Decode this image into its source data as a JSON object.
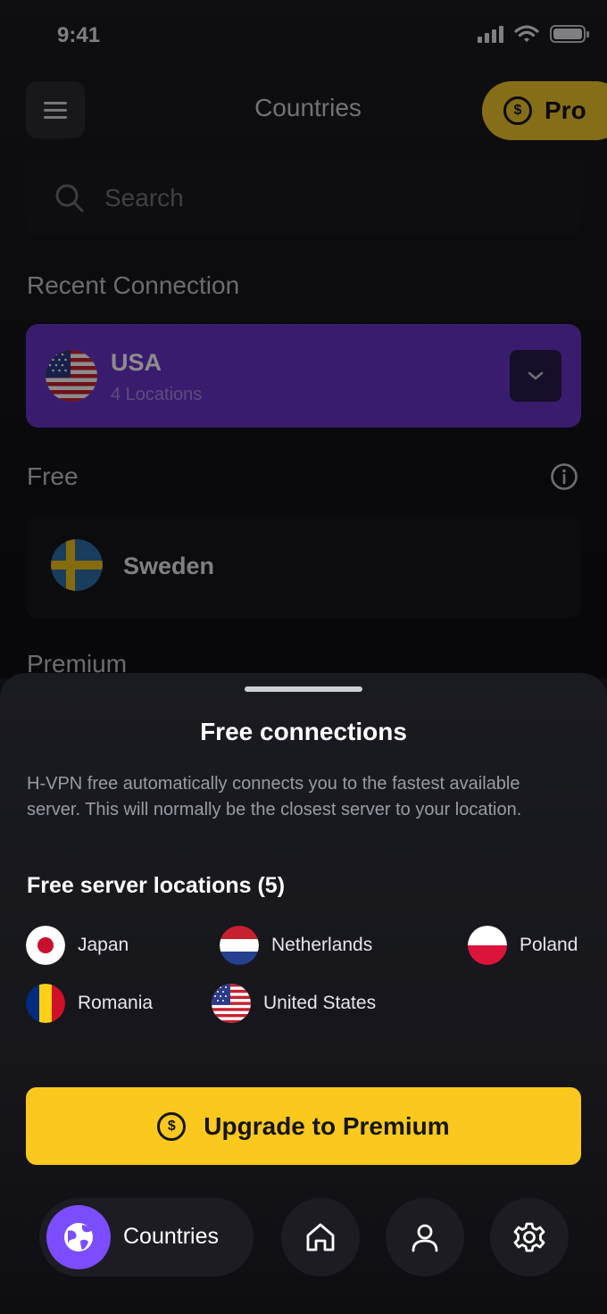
{
  "status_bar": {
    "time": "9:41"
  },
  "header": {
    "title": "Countries",
    "pro_label": "Pro",
    "coin_symbol": "$"
  },
  "search": {
    "placeholder": "Search"
  },
  "recent": {
    "section_label": "Recent Connection",
    "country": "USA",
    "subtitle": "4 Locations"
  },
  "free": {
    "section_label": "Free",
    "country": "Sweden"
  },
  "premium": {
    "section_label": "Premium"
  },
  "sheet": {
    "title": "Free connections",
    "description": "H-VPN free automatically connects you to the fastest available server. This will normally be the closest server to your location.",
    "locations_title": "Free server locations (5)",
    "locations": [
      {
        "name": "Japan",
        "flag": "japan-flag"
      },
      {
        "name": "Netherlands",
        "flag": "netherlands-flag"
      },
      {
        "name": "Poland",
        "flag": "poland-flag"
      },
      {
        "name": "Romania",
        "flag": "romania-flag"
      },
      {
        "name": "United States",
        "flag": "usa-flag"
      }
    ],
    "upgrade_label": "Upgrade to Premium"
  },
  "nav": {
    "countries_label": "Countries",
    "items": [
      "globe-icon",
      "home-icon",
      "user-icon",
      "gear-icon"
    ]
  },
  "colors": {
    "accent_purple": "#6a33c8",
    "nav_purple": "#7c4dff",
    "gold": "#fbc81d",
    "pro_gold": "#f2c82a"
  }
}
